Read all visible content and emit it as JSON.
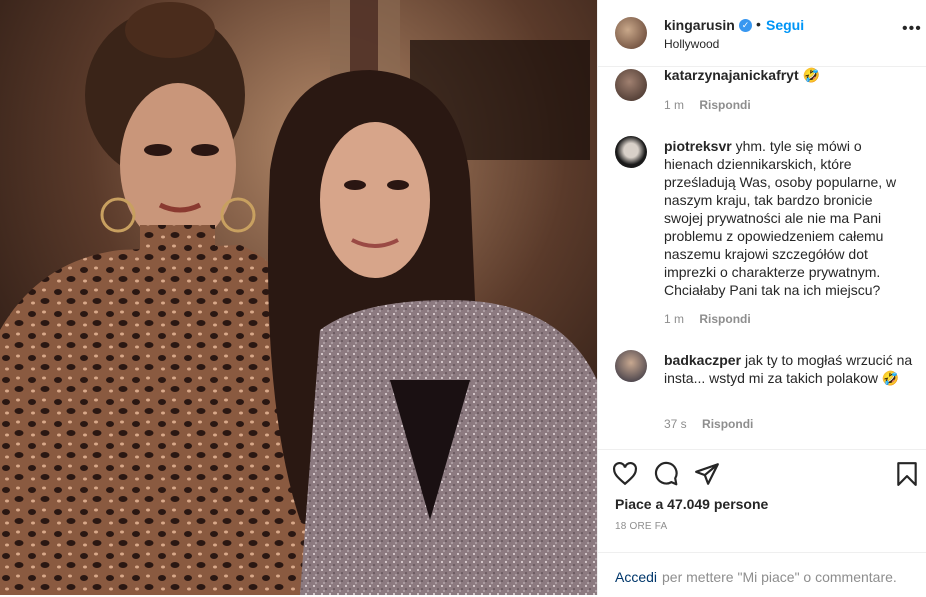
{
  "post": {
    "username": "kingarusin",
    "follow_label": "Segui",
    "separator": "•",
    "location": "Hollywood",
    "verified_icon": "verified-badge-icon",
    "more_icon": "more-options-icon"
  },
  "comments": [
    {
      "username": "katarzynajanickafryt",
      "text": "🤣",
      "age": "1 m",
      "reply_label": "Rispondi"
    },
    {
      "username": "piotreksvr",
      "text": "yhm. tyle się mówi o hienach dziennikarskich, które prześladują Was, osoby popularne, w naszym kraju, tak bardzo bronicie swojej prywatności ale nie ma Pani problemu z opowiedzeniem całemu naszemu krajowi szczegółów dot imprezki o charakterze prywatnym. Chciałaby Pani tak na ich miejscu?",
      "age": "1 m",
      "reply_label": "Rispondi"
    },
    {
      "username": "badkaczper",
      "text": "jak ty to mogłaś wrzucić na insta... wstyd mi za takich polakow 🤣",
      "age": "37 s",
      "reply_label": "Rispondi"
    }
  ],
  "actions": {
    "icons": [
      "heart-icon",
      "comment-icon",
      "share-icon",
      "bookmark-icon"
    ],
    "likes_text": "Piace a 47.049 persone",
    "time_text": "18 ORE FA"
  },
  "login": {
    "link_label": "Accedi",
    "rest_text": "per mettere \"Mi piace\" o commentare."
  },
  "colors": {
    "link_blue": "#0095f6",
    "verified_blue": "#3897f0",
    "meta_gray": "#8e8e8e",
    "border": "#efefef"
  }
}
